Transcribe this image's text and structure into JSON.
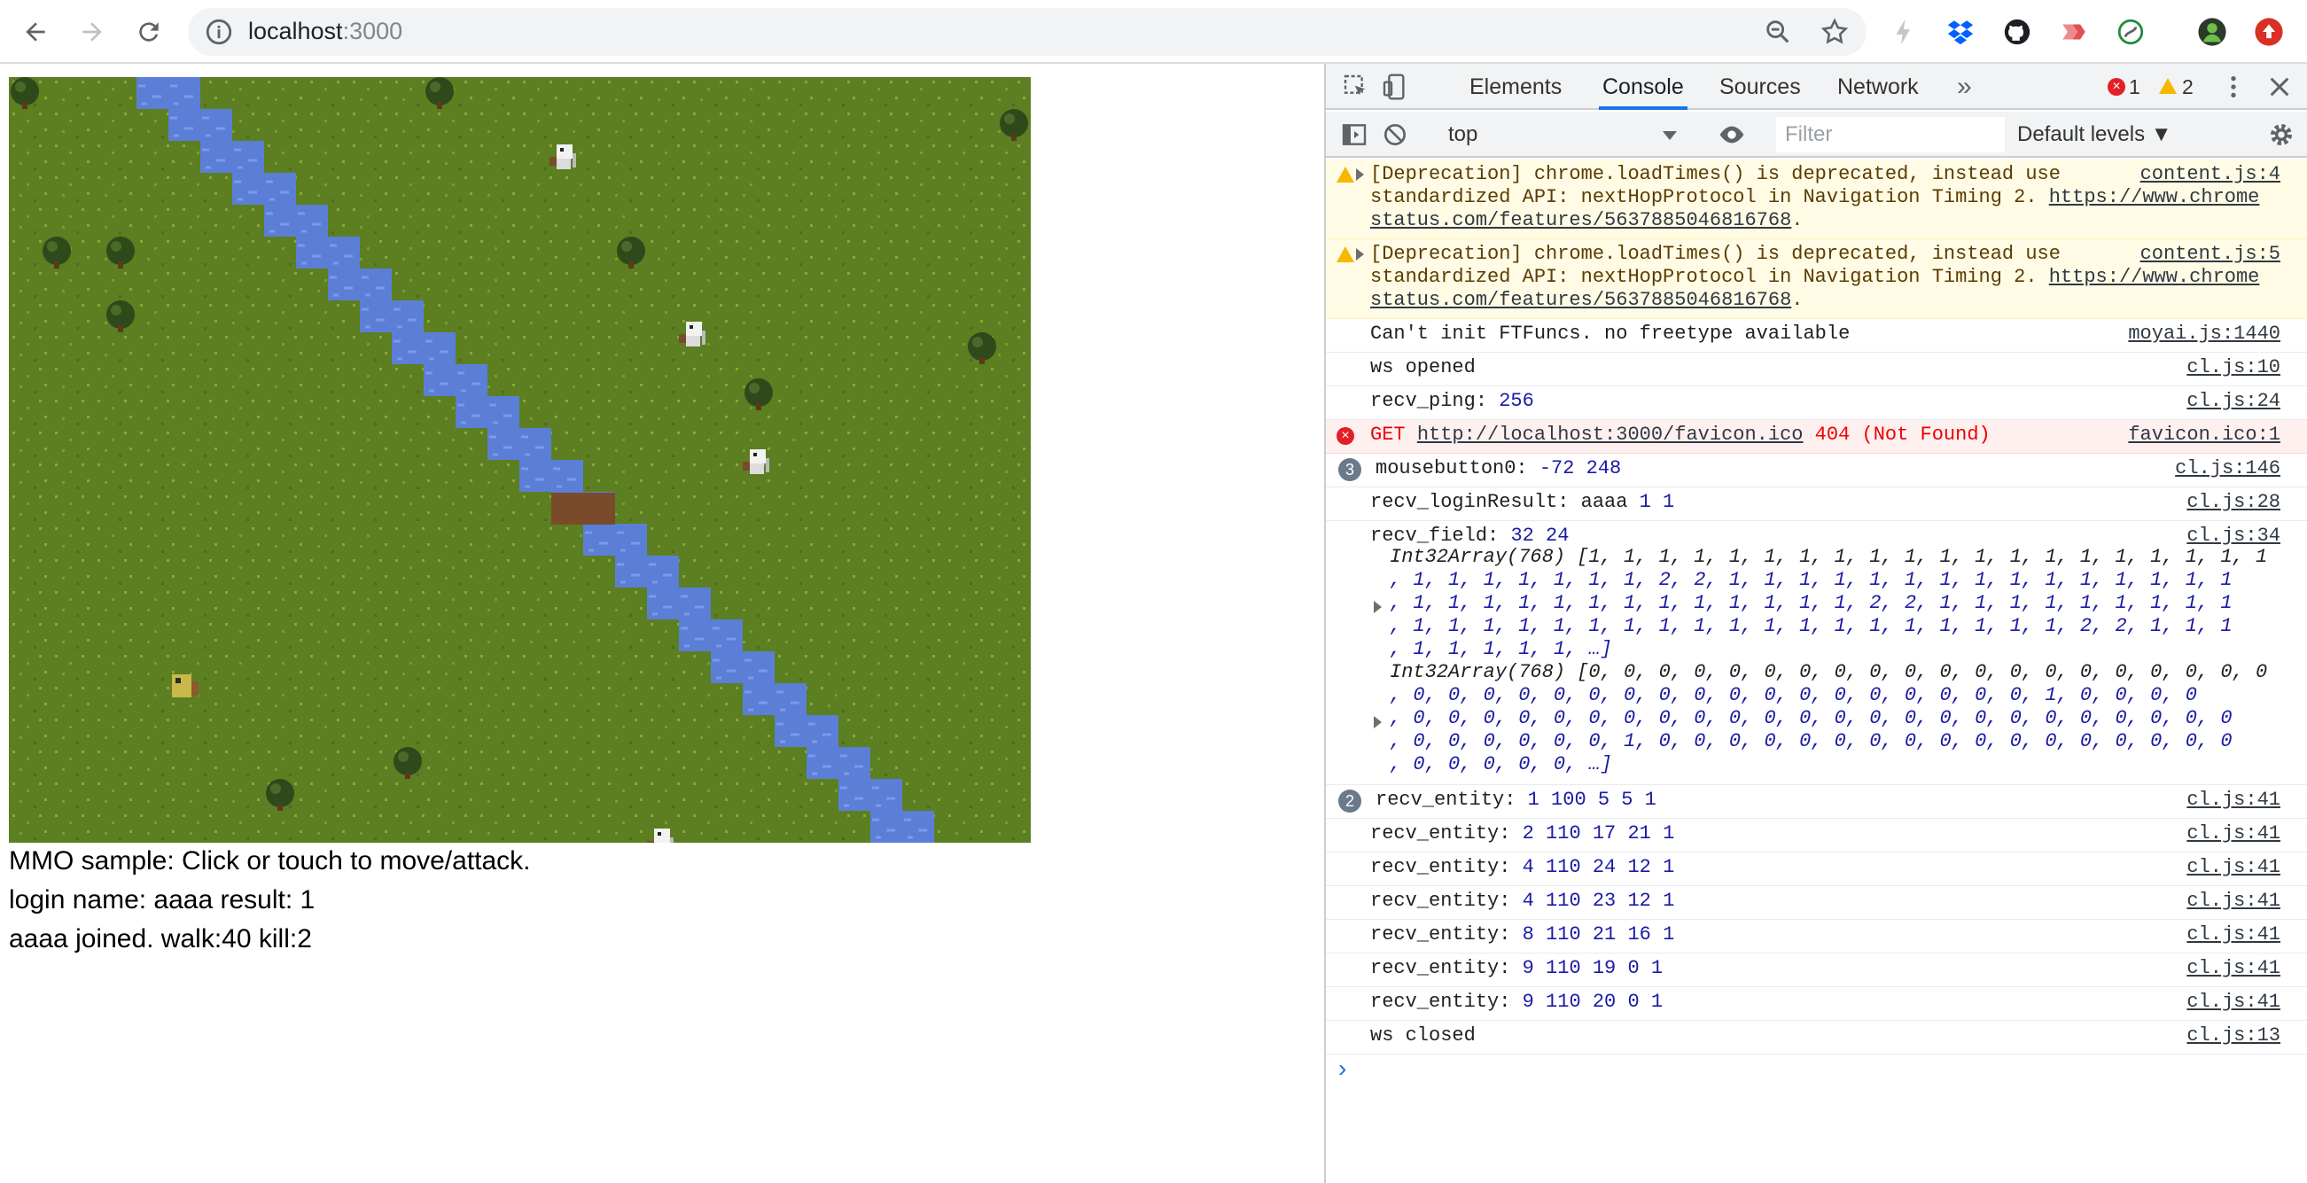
{
  "browser": {
    "url_host": "localhost",
    "url_port": ":3000",
    "icons": [
      "back-icon",
      "forward-icon",
      "reload-icon",
      "info-icon",
      "zoom-icon",
      "bookmark-star-icon",
      "bolt-icon",
      "dropbox-icon",
      "github-icon",
      "extension-icon",
      "extension-icon-2",
      "profile-avatar",
      "update-icon"
    ]
  },
  "game": {
    "line1": "MMO sample: Click or touch to move/attack.",
    "line2": "login name: aaaa result: 1",
    "line3": "aaaa joined. walk:40 kill:2",
    "colors": {
      "grass": "#5b7f21",
      "water": "#5b7fd6",
      "bridge": "#7a4b2a",
      "tree": "#2e4a1a"
    }
  },
  "devtools": {
    "tabs": [
      "Elements",
      "Console",
      "Sources",
      "Network"
    ],
    "more": "»",
    "error_count": "1",
    "warning_count": "2",
    "context": "top",
    "filter_placeholder": "Filter",
    "levels": "Default levels ▼",
    "prompt": "›"
  },
  "console": {
    "warn1": {
      "line1": "[Deprecation] chrome.loadTimes() is deprecated, instead use",
      "line2": "standardized API: nextHopProtocol in Navigation Timing 2. ",
      "link_a": "https://www.chrome",
      "link_b": "status.com/features/5637885046816768",
      "source": "content.js:4"
    },
    "warn2": {
      "line1": "[Deprecation] chrome.loadTimes() is deprecated, instead use",
      "line2": "standardized API: nextHopProtocol in Navigation Timing 2. ",
      "link_a": "https://www.chrome",
      "link_b": "status.com/features/5637885046816768",
      "source": "content.js:5"
    },
    "logs": [
      {
        "text": "Can't init FTFuncs. no freetype available",
        "source": "moyai.js:1440"
      },
      {
        "text": "ws opened",
        "source": "cl.js:10"
      },
      {
        "text": "recv_ping: ",
        "num": "256",
        "source": "cl.js:24"
      }
    ],
    "error": {
      "prefix": "GET ",
      "url": "http://localhost:3000/favicon.ico",
      "suffix": " 404 (Not Found)",
      "source": "favicon.ico:1"
    },
    "mouse": {
      "badge": "3",
      "text": "mousebutton0: ",
      "num": "-72 248",
      "source": "cl.js:146"
    },
    "login": {
      "text": "recv_loginResult: aaaa ",
      "num": "1 1",
      "source": "cl.js:28"
    },
    "field": {
      "text": "recv_field: ",
      "num": "32 24",
      "source": "cl.js:34"
    },
    "array1": [
      "Int32Array(768) [1, 1, 1, 1, 1, 1, 1, 1, 1, 1, 1, 1, 1, 1, 1, 1, 1, 1, 1, 1",
      ", 1, 1, 1, 1, 1, 1, 1, 2, 2, 1, 1, 1, 1, 1, 1, 1, 1, 1, 1, 1, 1, 1, 1, 1",
      ", 1, 1, 1, 1, 1, 1, 1, 1, 1, 1, 1, 1, 1, 2, 2, 1, 1, 1, 1, 1, 1, 1, 1, 1",
      ", 1, 1, 1, 1, 1, 1, 1, 1, 1, 1, 1, 1, 1, 1, 1, 1, 1, 1, 1, 2, 2, 1, 1, 1",
      ", 1, 1, 1, 1, 1, …]"
    ],
    "array2": [
      "Int32Array(768) [0, 0, 0, 0, 0, 0, 0, 0, 0, 0, 0, 0, 0, 0, 0, 0, 0, 0, 0, 0",
      ", 0, 0, 0, 0, 0, 0, 0, 0, 0, 0, 0, 0, 0, 0, 0, 0, 0, 0, 1, 0, 0, 0, 0",
      ", 0, 0, 0, 0, 0, 0, 0, 0, 0, 0, 0, 0, 0, 0, 0, 0, 0, 0, 0, 0, 0, 0, 0, 0",
      ", 0, 0, 0, 0, 0, 0, 1, 0, 0, 0, 0, 0, 0, 0, 0, 0, 0, 0, 0, 0, 0, 0, 0, 0",
      ", 0, 0, 0, 0, 0, …]"
    ],
    "entity_group": {
      "badge": "2",
      "text": "recv_entity: ",
      "num": "1 100 5 5 1",
      "source": "cl.js:41"
    },
    "entities": [
      {
        "text": "recv_entity: ",
        "num": "2 110 17 21 1",
        "source": "cl.js:41"
      },
      {
        "text": "recv_entity: ",
        "num": "4 110 24 12 1",
        "source": "cl.js:41"
      },
      {
        "text": "recv_entity: ",
        "num": "4 110 23 12 1",
        "source": "cl.js:41"
      },
      {
        "text": "recv_entity: ",
        "num": "8 110 21 16 1",
        "source": "cl.js:41"
      },
      {
        "text": "recv_entity: ",
        "num": "9 110 19 0 1",
        "source": "cl.js:41"
      },
      {
        "text": "recv_entity: ",
        "num": "9 110 20 0 1",
        "source": "cl.js:41"
      }
    ],
    "closed": {
      "text": "ws closed",
      "source": "cl.js:13"
    }
  }
}
